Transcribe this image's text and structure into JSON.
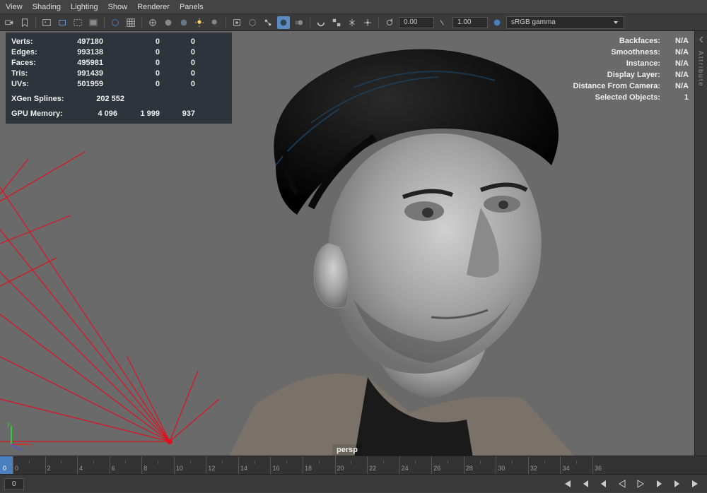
{
  "menu": {
    "items": [
      "View",
      "Shading",
      "Lighting",
      "Show",
      "Renderer",
      "Panels"
    ]
  },
  "toolbar": {
    "field1": "0.00",
    "field2": "1.00",
    "colorspace": "sRGB gamma"
  },
  "stats": {
    "rows": [
      {
        "label": "Verts:",
        "v1": "497180",
        "v2": "0",
        "v3": "0"
      },
      {
        "label": "Edges:",
        "v1": "993138",
        "v2": "0",
        "v3": "0"
      },
      {
        "label": "Faces:",
        "v1": "495981",
        "v2": "0",
        "v3": "0"
      },
      {
        "label": "Tris:",
        "v1": "991439",
        "v2": "0",
        "v3": "0"
      },
      {
        "label": "UVs:",
        "v1": "501959",
        "v2": "0",
        "v3": "0"
      }
    ],
    "xgen": {
      "label": "XGen Splines:",
      "value": "202 552"
    },
    "gpu": {
      "label": "GPU Memory:",
      "v1": "4 096",
      "v2": "1 999",
      "v3": "937"
    }
  },
  "info": {
    "rows": [
      {
        "label": "Backfaces:",
        "value": "N/A"
      },
      {
        "label": "Smoothness:",
        "value": "N/A"
      },
      {
        "label": "Instance:",
        "value": "N/A"
      },
      {
        "label": "Display Layer:",
        "value": "N/A"
      },
      {
        "label": "Distance From Camera:",
        "value": "N/A"
      },
      {
        "label": "Selected Objects:",
        "value": "1"
      }
    ]
  },
  "camera": "persp",
  "timeline": {
    "current": "0",
    "start": "0",
    "ticks": [
      "0",
      "2",
      "4",
      "6",
      "8",
      "10",
      "12",
      "14",
      "16",
      "18",
      "20",
      "22",
      "24",
      "26",
      "28",
      "30",
      "32",
      "34",
      "36"
    ]
  },
  "sidetab": "Attribute"
}
